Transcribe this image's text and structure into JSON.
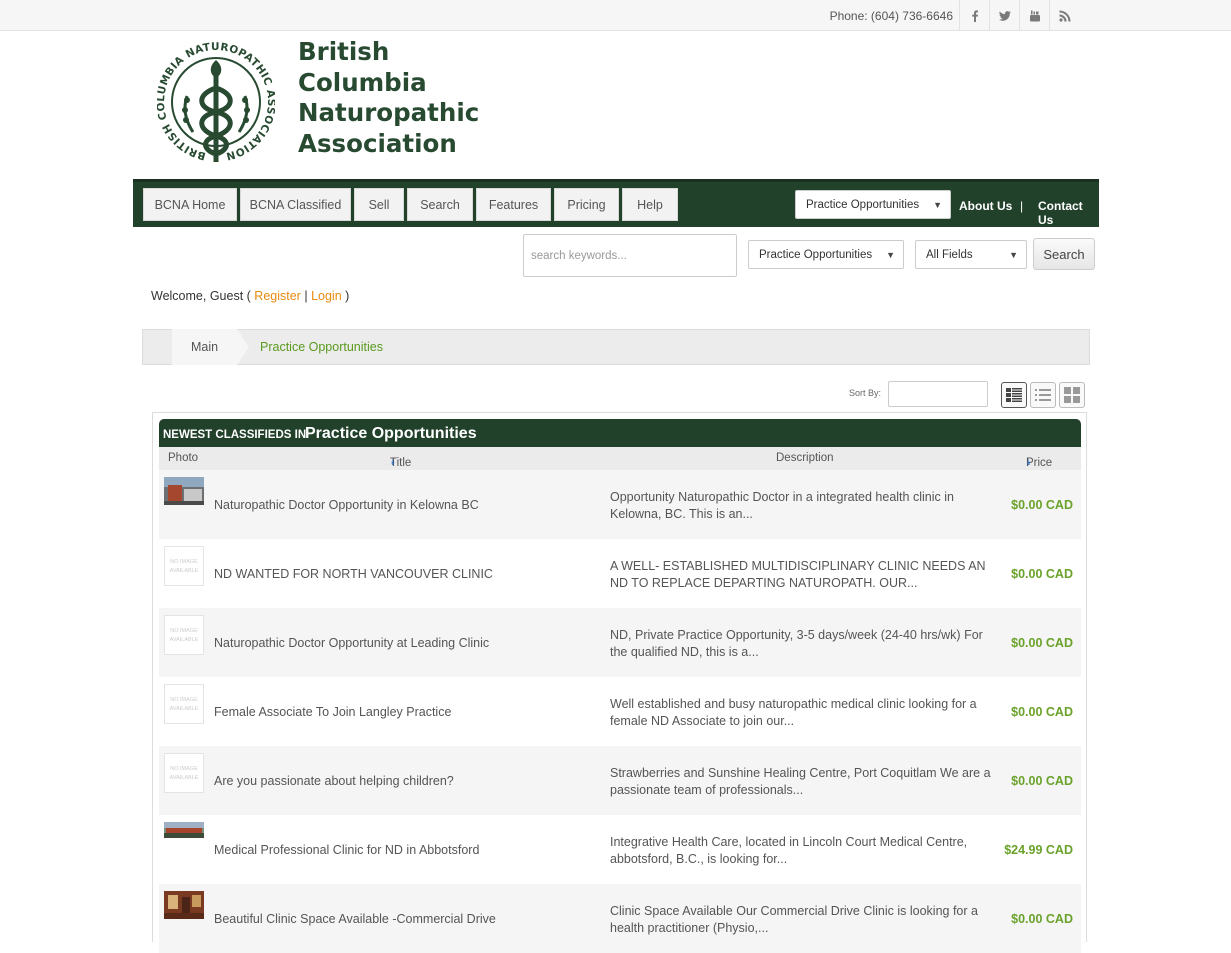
{
  "topbar": {
    "phone": "Phone: (604) 736-6646",
    "social": [
      "facebook-icon",
      "twitter-icon",
      "youtube-icon",
      "rss-icon"
    ]
  },
  "logo": {
    "lines": [
      "British",
      "Columbia",
      "Naturopathic",
      "Association"
    ],
    "seal_text": "BRITISH COLUMBIA NATUROPATHIC ASSOCIATION"
  },
  "nav": {
    "items": [
      "BCNA Home",
      "BCNA Classified",
      "Sell",
      "Search",
      "Features",
      "Pricing",
      "Help"
    ],
    "category_select": "Practice Opportunities",
    "about": "About Us",
    "sep": "|",
    "contact": "Contact Us"
  },
  "search": {
    "placeholder": "search keywords...",
    "category": "Practice Opportunities",
    "fields": "All Fields",
    "button": "Search"
  },
  "welcome": {
    "prefix": "Welcome, Guest (",
    "register": "Register",
    "sep": "|",
    "login": "Login",
    "suffix": ")"
  },
  "breadcrumb": {
    "main": "Main",
    "current": "Practice Opportunities"
  },
  "sort": {
    "label": "Sort By:",
    "value": ""
  },
  "listing": {
    "heading_small": "NEWEST CLASSIFIEDS IN",
    "heading_big": "Practice Opportunities",
    "columns": {
      "photo": "Photo",
      "title": "Title",
      "description": "Description",
      "price": "Price"
    },
    "no_image_text": "NO IMAGE AVAILABLE",
    "rows": [
      {
        "title": "Naturopathic Doctor Opportunity in Kelowna BC",
        "description": "Opportunity Naturopathic Doctor in a integrated health clinic in Kelowna, BC. This is an...",
        "price": "$0.00 CAD",
        "photo": "building"
      },
      {
        "title": "ND WANTED FOR NORTH VANCOUVER CLINIC",
        "description": "A WELL- ESTABLISHED MULTIDISCIPLINARY CLINIC NEEDS AN ND TO REPLACE DEPARTING NATUROPATH. OUR...",
        "price": "$0.00 CAD",
        "photo": "none"
      },
      {
        "title": "Naturopathic Doctor Opportunity at Leading Clinic",
        "description": "ND, Private Practice Opportunity, 3-5 days/week (24-40 hrs/wk) For the qualified ND, this is a...",
        "price": "$0.00 CAD",
        "photo": "none"
      },
      {
        "title": "Female Associate To Join Langley Practice",
        "description": "Well established and busy naturopathic medical clinic looking for a female ND Associate to join our...",
        "price": "$0.00 CAD",
        "photo": "none"
      },
      {
        "title": "Are you passionate about helping children?",
        "description": "Strawberries and Sunshine Healing Centre, Port Coquitlam We are a passionate team of professionals...",
        "price": "$0.00 CAD",
        "photo": "none"
      },
      {
        "title": "Medical Professional Clinic for ND in Abbotsford",
        "description": "Integrative Health Care, located in Lincoln Court Medical Centre, abbotsford, B.C., is looking for...",
        "price": "$24.99 CAD",
        "photo": "street"
      },
      {
        "title": "Beautiful Clinic Space Available -Commercial Drive",
        "description": "Clinic Space Available Our Commercial Drive Clinic is looking for a health practitioner (Physio,...",
        "price": "$0.00 CAD",
        "photo": "room"
      }
    ]
  },
  "colors": {
    "brand_green": "#22412b",
    "link_orange": "#e78b0f",
    "price_green": "#6aa22b"
  }
}
